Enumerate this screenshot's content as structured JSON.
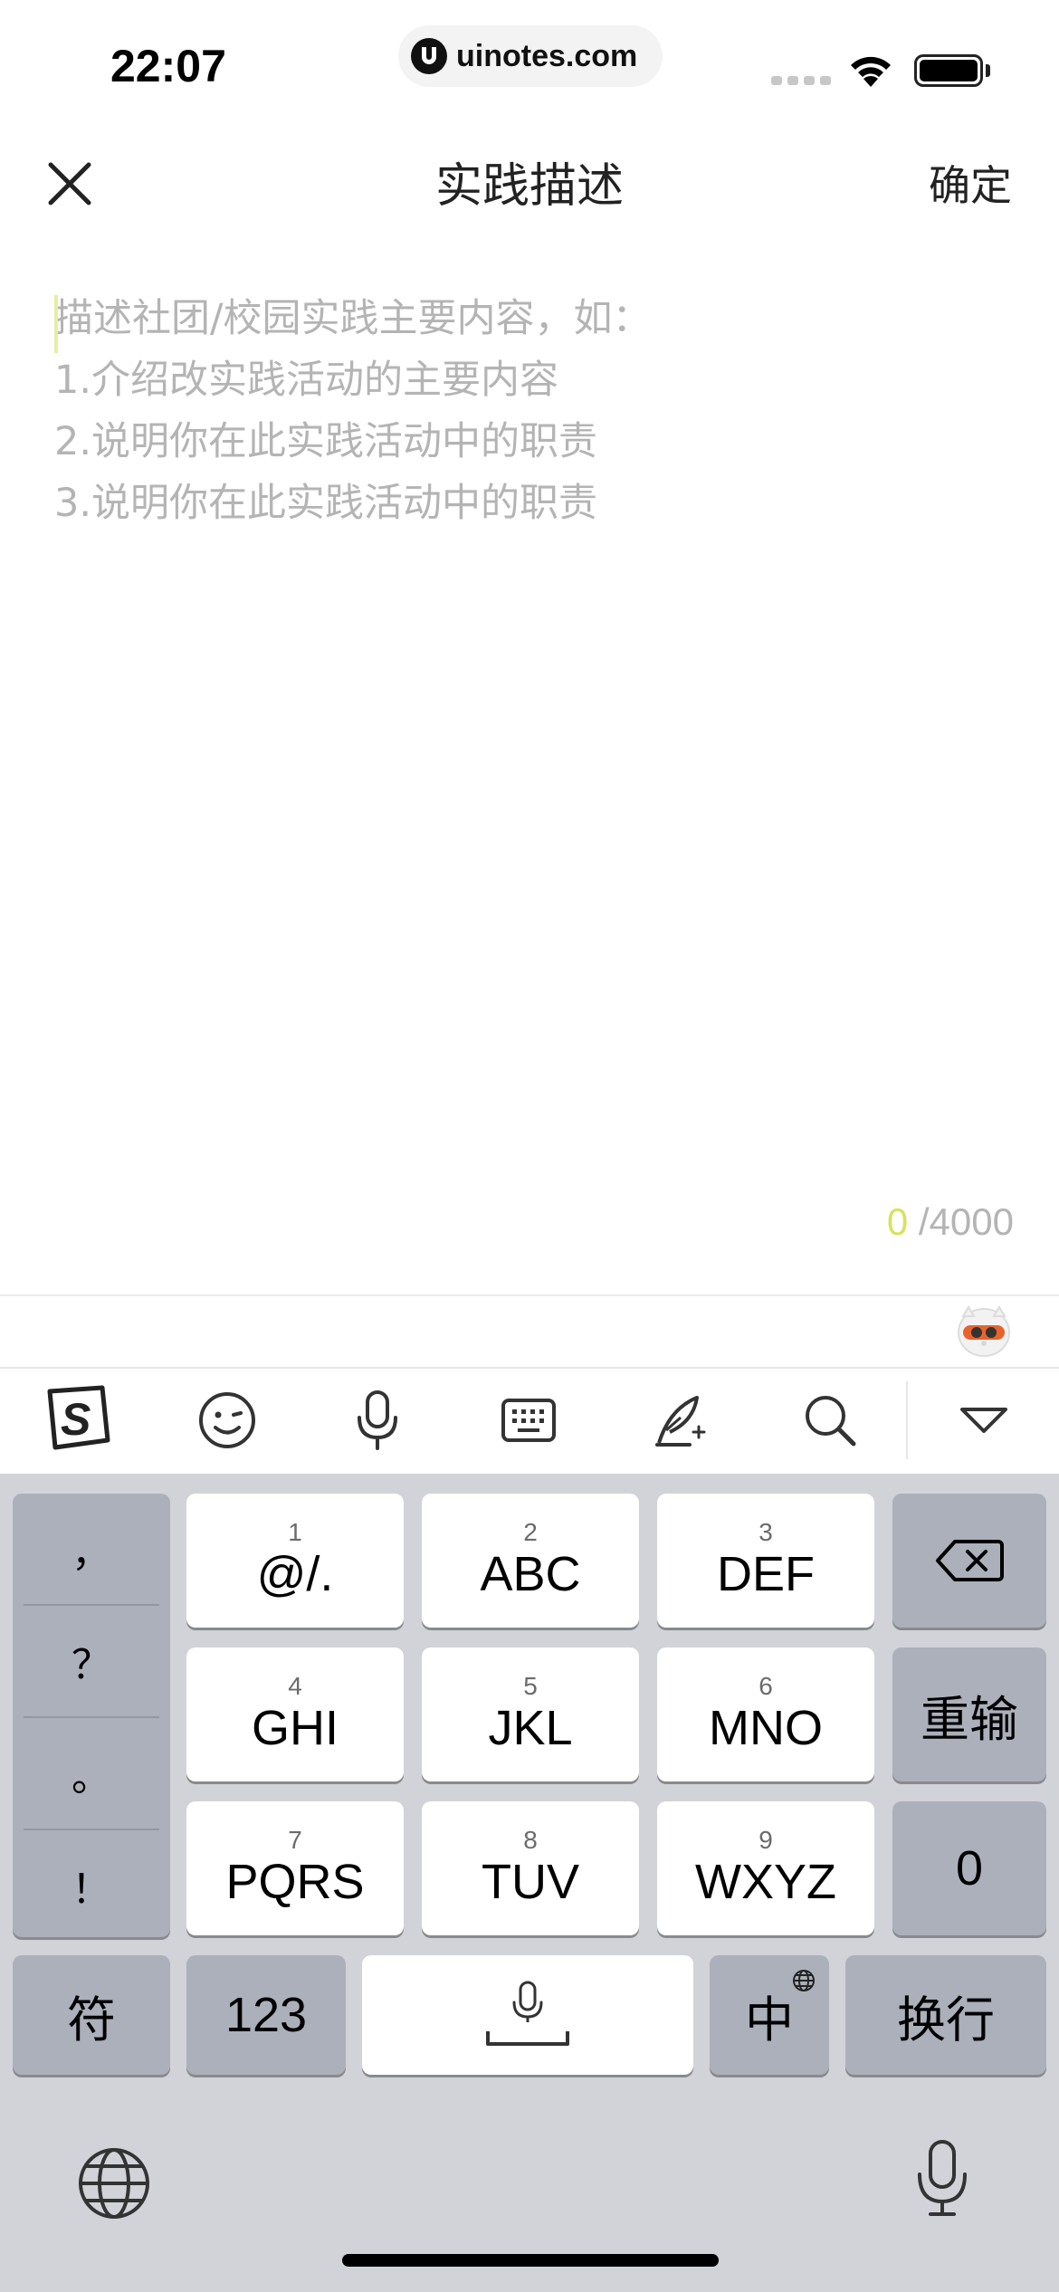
{
  "status_bar": {
    "time": "22:07",
    "url": "uinotes.com"
  },
  "nav": {
    "title": "实践描述",
    "confirm_label": "确定"
  },
  "editor": {
    "placeholder_lines": [
      "描述社团/校园实践主要内容，如：",
      "1.介绍改实践活动的主要内容",
      "2.说明你在此实践活动中的职责",
      "3.说明你在此实践活动中的职责"
    ],
    "counter_current": "0",
    "counter_max": " /4000"
  },
  "toolbar": {
    "icons": [
      "sogou-logo-icon",
      "emoji-icon",
      "microphone-icon",
      "keyboard-icon",
      "quill-icon",
      "search-icon",
      "collapse-icon"
    ]
  },
  "keyboard": {
    "punctuation": [
      "，",
      "？",
      "。",
      "！"
    ],
    "keys": [
      {
        "num": "1",
        "letters": "@/."
      },
      {
        "num": "2",
        "letters": "ABC"
      },
      {
        "num": "3",
        "letters": "DEF"
      },
      {
        "num": "4",
        "letters": "GHI"
      },
      {
        "num": "5",
        "letters": "JKL"
      },
      {
        "num": "6",
        "letters": "MNO"
      },
      {
        "num": "7",
        "letters": "PQRS"
      },
      {
        "num": "8",
        "letters": "TUV"
      },
      {
        "num": "9",
        "letters": "WXYZ"
      }
    ],
    "reenter_label": "重输",
    "zero_label": "0",
    "symbols_label": "符",
    "numbers_label": "123",
    "chinese_label": "中",
    "newline_label": "换行"
  },
  "colors": {
    "accent": "#d6e35c",
    "keyboard_bg": "#d1d3d9",
    "dark_key": "#abb0bb"
  }
}
